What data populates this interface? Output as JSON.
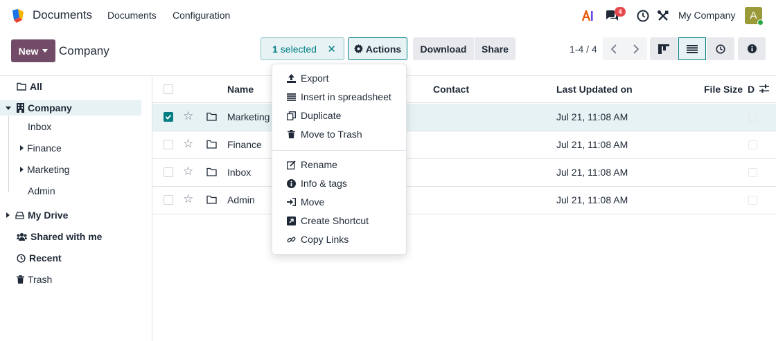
{
  "app": {
    "name": "Documents",
    "menus": [
      "Documents",
      "Configuration"
    ],
    "chat_badge": "4",
    "company": "My Company",
    "avatar_letter": "A",
    "brand_color": "#714b67",
    "accent_color": "#017e84"
  },
  "control": {
    "new_label": "New",
    "breadcrumb": "Company",
    "selected_count": "1",
    "selected_label": "selected",
    "actions_label": "Actions",
    "download_label": "Download",
    "share_label": "Share",
    "pager": "1-4 / 4"
  },
  "sidebar": {
    "all": "All",
    "company": "Company",
    "children": [
      "Inbox",
      "Finance",
      "Marketing",
      "Admin"
    ],
    "my_drive": "My Drive",
    "shared": "Shared with me",
    "recent": "Recent",
    "trash": "Trash"
  },
  "table": {
    "headers": {
      "name": "Name",
      "contact": "Contact",
      "last_updated": "Last Updated on",
      "file_size": "File Size",
      "d": "D"
    },
    "rows": [
      {
        "name": "Marketing",
        "updated": "Jul 21, 11:08 AM",
        "selected": true
      },
      {
        "name": "Finance",
        "updated": "Jul 21, 11:08 AM",
        "selected": false
      },
      {
        "name": "Inbox",
        "updated": "Jul 21, 11:08 AM",
        "selected": false
      },
      {
        "name": "Admin",
        "updated": "Jul 21, 11:08 AM",
        "selected": false
      }
    ]
  },
  "actions_menu": {
    "group1": [
      "Export",
      "Insert in spreadsheet",
      "Duplicate",
      "Move to Trash"
    ],
    "group2": [
      "Rename",
      "Info & tags",
      "Move",
      "Create Shortcut",
      "Copy Links"
    ]
  }
}
